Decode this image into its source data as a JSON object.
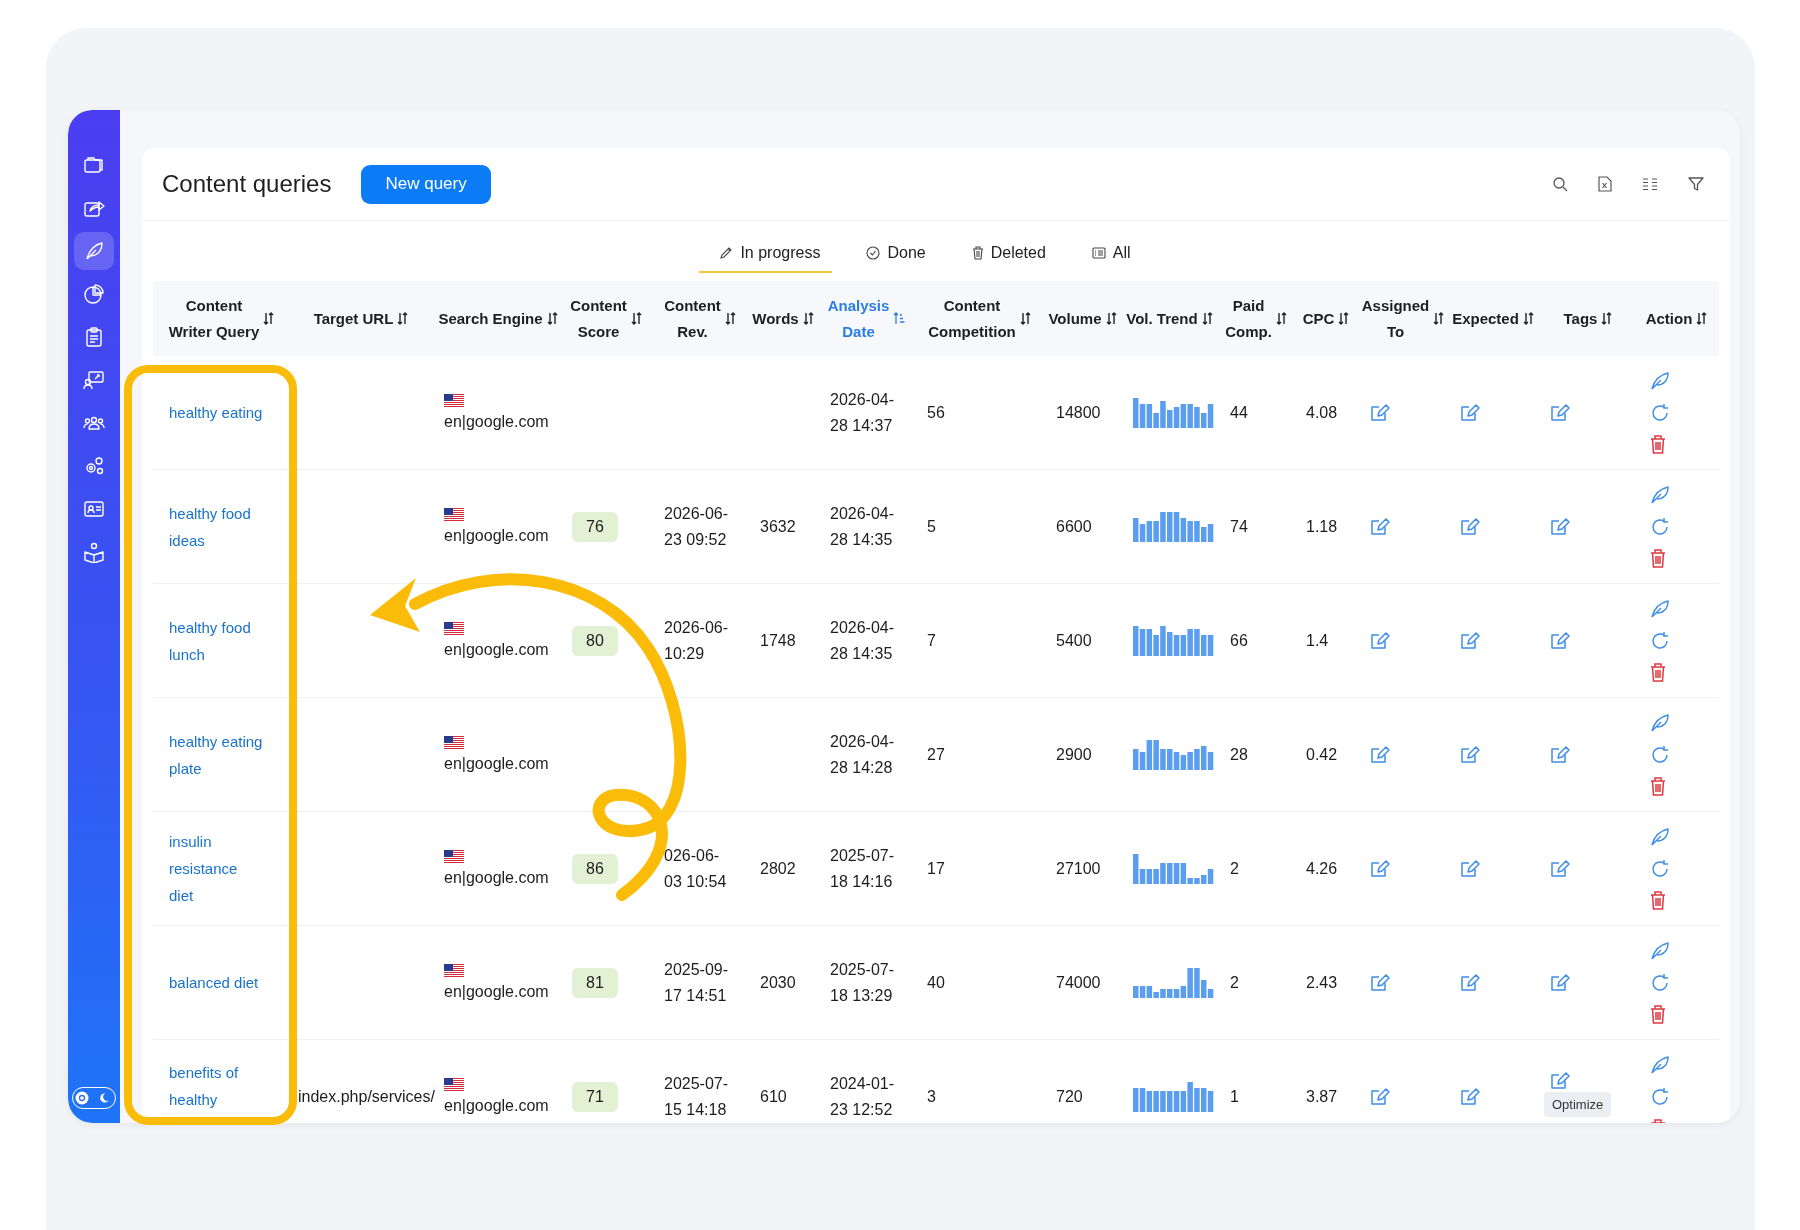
{
  "sidebar": {
    "items": [
      {
        "selected": false
      },
      {
        "selected": false
      },
      {
        "selected": true
      },
      {
        "selected": false
      },
      {
        "selected": false
      },
      {
        "selected": false
      },
      {
        "selected": false
      },
      {
        "selected": false
      },
      {
        "selected": false
      },
      {
        "selected": false
      }
    ]
  },
  "theme_toggle": {
    "dark": false
  },
  "header": {
    "title": "Content queries",
    "new_button": "New query"
  },
  "tabs": [
    {
      "label": "In progress",
      "selected": true
    },
    {
      "label": "Done",
      "selected": false
    },
    {
      "label": "Deleted",
      "selected": false
    },
    {
      "label": "All",
      "selected": false
    }
  ],
  "table": {
    "columns": [
      {
        "label": "Content\nWriter Query",
        "sorted": false
      },
      {
        "label": "Target URL",
        "sorted": false
      },
      {
        "label": "Search Engine",
        "sorted": false
      },
      {
        "label": "Content\nScore",
        "sorted": false
      },
      {
        "label": "Content\nRev.",
        "sorted": false
      },
      {
        "label": "Words",
        "sorted": false
      },
      {
        "label": "Analysis\nDate",
        "sorted": true
      },
      {
        "label": "Content\nCompetition",
        "sorted": false
      },
      {
        "label": "Volume",
        "sorted": false
      },
      {
        "label": "Vol. Trend",
        "sorted": false
      },
      {
        "label": "Paid\nComp.",
        "sorted": false
      },
      {
        "label": "CPC",
        "sorted": false
      },
      {
        "label": "Assigned\nTo",
        "sorted": false
      },
      {
        "label": "Expected",
        "sorted": false
      },
      {
        "label": "Tags",
        "sorted": false
      },
      {
        "label": "Action",
        "sorted": false
      }
    ],
    "rows": [
      {
        "query": "healthy eating",
        "engine": "en|google.com",
        "analysis_date": "2026-04-\n28 14:37",
        "competition": "56",
        "volume": "14800",
        "paid_comp": "44",
        "cpc": "4.08"
      },
      {
        "query": "healthy food\nideas",
        "engine": "en|google.com",
        "score": "76",
        "content_rev": "2026-06-\n23 09:52",
        "words": "3632",
        "analysis_date": "2026-04-\n28 14:35",
        "competition": "5",
        "volume": "6600",
        "paid_comp": "74",
        "cpc": "1.18"
      },
      {
        "query": "healthy food\nlunch",
        "engine": "en|google.com",
        "score": "80",
        "content_rev": "2026-06-\n10:29",
        "words": "1748",
        "analysis_date": "2026-04-\n28 14:35",
        "competition": "7",
        "volume": "5400",
        "paid_comp": "66",
        "cpc": "1.4"
      },
      {
        "query": "healthy eating\nplate",
        "engine": "en|google.com",
        "analysis_date": "2026-04-\n28 14:28",
        "competition": "27",
        "volume": "2900",
        "paid_comp": "28",
        "cpc": "0.42"
      },
      {
        "query": "insulin\nresistance\ndiet",
        "engine": "en|google.com",
        "score": "86",
        "content_rev": "026-06-\n03 10:54",
        "words": "2802",
        "analysis_date": "2025-07-\n18 14:16",
        "competition": "17",
        "volume": "27100",
        "paid_comp": "2",
        "cpc": "4.26"
      },
      {
        "query": "balanced diet",
        "engine": "en|google.com",
        "score": "81",
        "content_rev": "2025-09-\n17 14:51",
        "words": "2030",
        "analysis_date": "2025-07-\n18 13:29",
        "competition": "40",
        "volume": "74000",
        "paid_comp": "2",
        "cpc": "2.43"
      },
      {
        "query": "benefits of\nhealthy",
        "target_url": "index.php/services/",
        "engine": "en|google.com",
        "score": "71",
        "content_rev": "2025-07-\n15 14:18",
        "words": "610",
        "analysis_date": "2024-01-\n23 12:52",
        "competition": "3",
        "volume": "720",
        "paid_comp": "1",
        "cpc": "3.87",
        "tooltip": "Optimize"
      }
    ]
  }
}
